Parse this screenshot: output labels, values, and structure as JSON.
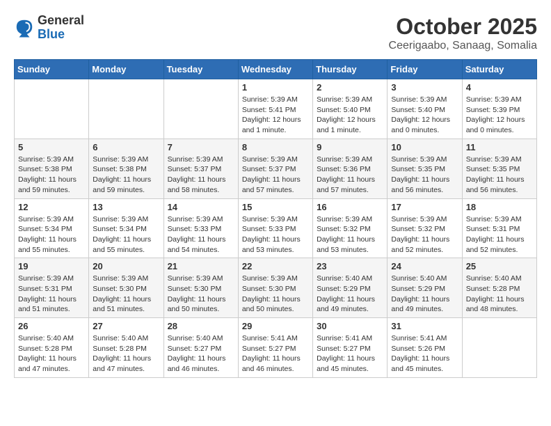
{
  "header": {
    "logo_general": "General",
    "logo_blue": "Blue",
    "month_title": "October 2025",
    "subtitle": "Ceerigaabo, Sanaag, Somalia"
  },
  "days_of_week": [
    "Sunday",
    "Monday",
    "Tuesday",
    "Wednesday",
    "Thursday",
    "Friday",
    "Saturday"
  ],
  "weeks": [
    [
      {
        "day": "",
        "info": ""
      },
      {
        "day": "",
        "info": ""
      },
      {
        "day": "",
        "info": ""
      },
      {
        "day": "1",
        "info": "Sunrise: 5:39 AM\nSunset: 5:41 PM\nDaylight: 12 hours\nand 1 minute."
      },
      {
        "day": "2",
        "info": "Sunrise: 5:39 AM\nSunset: 5:40 PM\nDaylight: 12 hours\nand 1 minute."
      },
      {
        "day": "3",
        "info": "Sunrise: 5:39 AM\nSunset: 5:40 PM\nDaylight: 12 hours\nand 0 minutes."
      },
      {
        "day": "4",
        "info": "Sunrise: 5:39 AM\nSunset: 5:39 PM\nDaylight: 12 hours\nand 0 minutes."
      }
    ],
    [
      {
        "day": "5",
        "info": "Sunrise: 5:39 AM\nSunset: 5:38 PM\nDaylight: 11 hours\nand 59 minutes."
      },
      {
        "day": "6",
        "info": "Sunrise: 5:39 AM\nSunset: 5:38 PM\nDaylight: 11 hours\nand 59 minutes."
      },
      {
        "day": "7",
        "info": "Sunrise: 5:39 AM\nSunset: 5:37 PM\nDaylight: 11 hours\nand 58 minutes."
      },
      {
        "day": "8",
        "info": "Sunrise: 5:39 AM\nSunset: 5:37 PM\nDaylight: 11 hours\nand 57 minutes."
      },
      {
        "day": "9",
        "info": "Sunrise: 5:39 AM\nSunset: 5:36 PM\nDaylight: 11 hours\nand 57 minutes."
      },
      {
        "day": "10",
        "info": "Sunrise: 5:39 AM\nSunset: 5:35 PM\nDaylight: 11 hours\nand 56 minutes."
      },
      {
        "day": "11",
        "info": "Sunrise: 5:39 AM\nSunset: 5:35 PM\nDaylight: 11 hours\nand 56 minutes."
      }
    ],
    [
      {
        "day": "12",
        "info": "Sunrise: 5:39 AM\nSunset: 5:34 PM\nDaylight: 11 hours\nand 55 minutes."
      },
      {
        "day": "13",
        "info": "Sunrise: 5:39 AM\nSunset: 5:34 PM\nDaylight: 11 hours\nand 55 minutes."
      },
      {
        "day": "14",
        "info": "Sunrise: 5:39 AM\nSunset: 5:33 PM\nDaylight: 11 hours\nand 54 minutes."
      },
      {
        "day": "15",
        "info": "Sunrise: 5:39 AM\nSunset: 5:33 PM\nDaylight: 11 hours\nand 53 minutes."
      },
      {
        "day": "16",
        "info": "Sunrise: 5:39 AM\nSunset: 5:32 PM\nDaylight: 11 hours\nand 53 minutes."
      },
      {
        "day": "17",
        "info": "Sunrise: 5:39 AM\nSunset: 5:32 PM\nDaylight: 11 hours\nand 52 minutes."
      },
      {
        "day": "18",
        "info": "Sunrise: 5:39 AM\nSunset: 5:31 PM\nDaylight: 11 hours\nand 52 minutes."
      }
    ],
    [
      {
        "day": "19",
        "info": "Sunrise: 5:39 AM\nSunset: 5:31 PM\nDaylight: 11 hours\nand 51 minutes."
      },
      {
        "day": "20",
        "info": "Sunrise: 5:39 AM\nSunset: 5:30 PM\nDaylight: 11 hours\nand 51 minutes."
      },
      {
        "day": "21",
        "info": "Sunrise: 5:39 AM\nSunset: 5:30 PM\nDaylight: 11 hours\nand 50 minutes."
      },
      {
        "day": "22",
        "info": "Sunrise: 5:39 AM\nSunset: 5:30 PM\nDaylight: 11 hours\nand 50 minutes."
      },
      {
        "day": "23",
        "info": "Sunrise: 5:40 AM\nSunset: 5:29 PM\nDaylight: 11 hours\nand 49 minutes."
      },
      {
        "day": "24",
        "info": "Sunrise: 5:40 AM\nSunset: 5:29 PM\nDaylight: 11 hours\nand 49 minutes."
      },
      {
        "day": "25",
        "info": "Sunrise: 5:40 AM\nSunset: 5:28 PM\nDaylight: 11 hours\nand 48 minutes."
      }
    ],
    [
      {
        "day": "26",
        "info": "Sunrise: 5:40 AM\nSunset: 5:28 PM\nDaylight: 11 hours\nand 47 minutes."
      },
      {
        "day": "27",
        "info": "Sunrise: 5:40 AM\nSunset: 5:28 PM\nDaylight: 11 hours\nand 47 minutes."
      },
      {
        "day": "28",
        "info": "Sunrise: 5:40 AM\nSunset: 5:27 PM\nDaylight: 11 hours\nand 46 minutes."
      },
      {
        "day": "29",
        "info": "Sunrise: 5:41 AM\nSunset: 5:27 PM\nDaylight: 11 hours\nand 46 minutes."
      },
      {
        "day": "30",
        "info": "Sunrise: 5:41 AM\nSunset: 5:27 PM\nDaylight: 11 hours\nand 45 minutes."
      },
      {
        "day": "31",
        "info": "Sunrise: 5:41 AM\nSunset: 5:26 PM\nDaylight: 11 hours\nand 45 minutes."
      },
      {
        "day": "",
        "info": ""
      }
    ]
  ]
}
